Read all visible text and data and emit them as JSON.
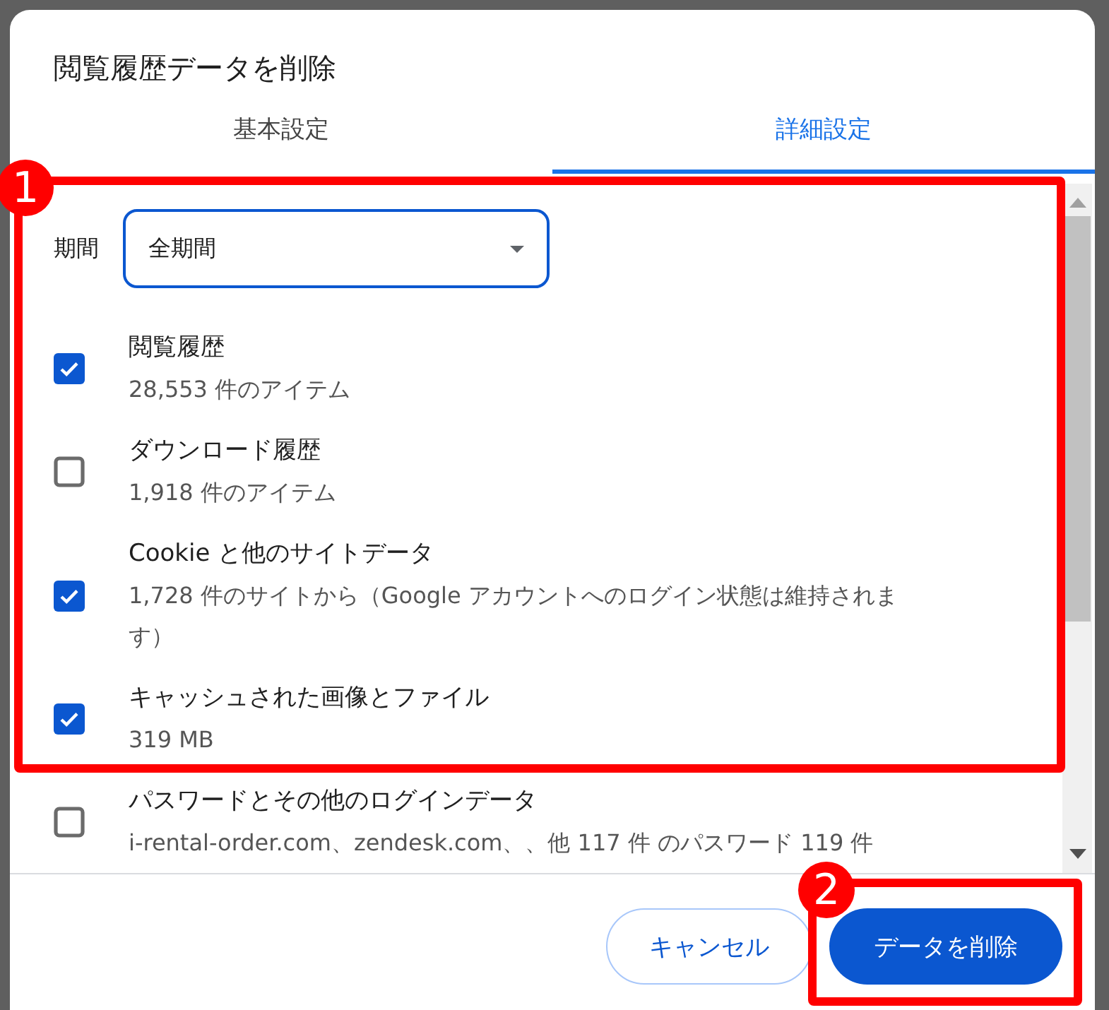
{
  "dialog": {
    "title": "閲覧履歴データを削除"
  },
  "tabs": [
    {
      "label": "基本設定",
      "selected": false
    },
    {
      "label": "詳細設定",
      "selected": true
    }
  ],
  "period": {
    "label": "期間",
    "value": "全期間"
  },
  "items": [
    {
      "label": "閲覧履歴",
      "detail": "28,553 件のアイテム",
      "checked": true
    },
    {
      "label": "ダウンロード履歴",
      "detail": "1,918 件のアイテム",
      "checked": false
    },
    {
      "label": "Cookie と他のサイトデータ",
      "detail": "1,728 件のサイトから（Google アカウントへのログイン状態は維持されます）",
      "checked": true
    },
    {
      "label": "キャッシュされた画像とファイル",
      "detail": "319 MB",
      "checked": true
    },
    {
      "label": "パスワードとその他のログインデータ",
      "detail": "i-rental-order.com、zendesk.com、、他 117 件 のパスワード 119 件",
      "checked": false
    }
  ],
  "buttons": [
    {
      "label": "キャンセル",
      "kind": "secondary"
    },
    {
      "label": "データを削除",
      "kind": "primary"
    }
  ],
  "annotations": [
    {
      "label": "1"
    },
    {
      "label": "2"
    }
  ]
}
